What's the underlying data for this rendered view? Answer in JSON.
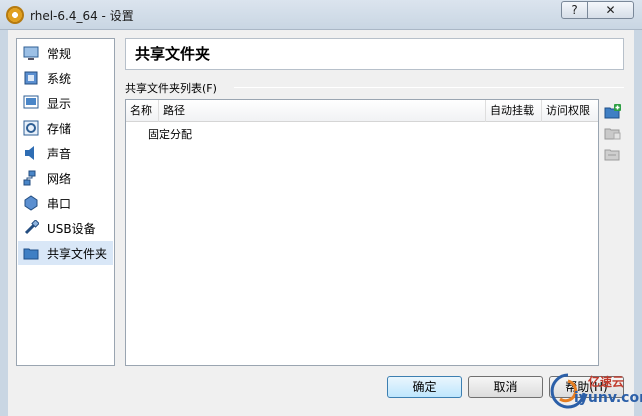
{
  "window": {
    "title": "rhel-6.4_64 - 设置",
    "help_label": "?",
    "close_label": "✕"
  },
  "sidebar": {
    "items": [
      {
        "label": "常规",
        "icon": "general-icon"
      },
      {
        "label": "系统",
        "icon": "system-icon"
      },
      {
        "label": "显示",
        "icon": "display-icon"
      },
      {
        "label": "存储",
        "icon": "storage-icon"
      },
      {
        "label": "声音",
        "icon": "audio-icon"
      },
      {
        "label": "网络",
        "icon": "network-icon"
      },
      {
        "label": "串口",
        "icon": "serial-port-icon"
      },
      {
        "label": "USB设备",
        "icon": "usb-icon"
      },
      {
        "label": "共享文件夹",
        "icon": "shared-folder-icon",
        "selected": true
      }
    ]
  },
  "main": {
    "title": "共享文件夹",
    "list_label": "共享文件夹列表(F)",
    "columns": [
      "名称",
      "路径",
      "自动挂载",
      "访问权限"
    ],
    "groups": [
      "固定分配"
    ]
  },
  "buttons": {
    "ok": "确定",
    "cancel": "取消",
    "help": "帮助(H)"
  },
  "watermark": {
    "line1": "亿速云",
    "line2": "iyunv.com"
  },
  "colors": {
    "accent": "#3c7fb1",
    "selection": "#d9e7f7"
  }
}
